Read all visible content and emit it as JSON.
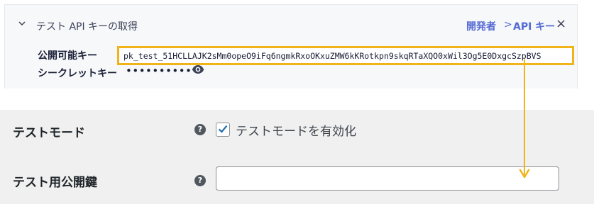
{
  "api_panel": {
    "title": "テスト API キーの取得",
    "breadcrumb_developers": "開発者",
    "breadcrumb_sep": ">",
    "breadcrumb_api_keys": "API キー",
    "close": "×",
    "publishable_key_label": "公開可能キー",
    "publishable_key_value": "pk_test_51HCLLAJK2sMm0opeO9iFq6ngmkRxoOKxuZMW6kKRotkpn9skqRTaXQO0xWil3Og5E0DxgcSzpBVS",
    "secret_key_label": "シークレットキー",
    "secret_key_masked": "••••••••••••"
  },
  "settings": {
    "test_mode_label": "テストモード",
    "test_mode_checkbox_label": "テストモードを有効化",
    "test_mode_checked": true,
    "test_pk_label": "テスト用公開鍵",
    "test_pk_value": "",
    "help_glyph": "?"
  },
  "colors": {
    "highlight": "#f0b41a",
    "link": "#5469d4",
    "checkbox_check": "#2271b1"
  }
}
